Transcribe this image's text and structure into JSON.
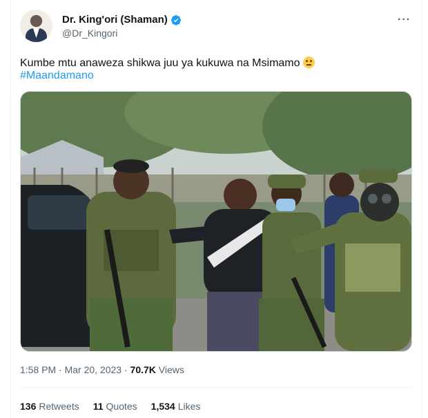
{
  "author": {
    "name": "Dr. King'ori (Shaman)",
    "handle": "@Dr_Kingori",
    "verified": true
  },
  "tweet": {
    "text": "Kumbe mtu anaweza shikwa juu ya kukuwa na Msimamo",
    "emoji": "thinking-face",
    "hashtag": "#Maandamano",
    "photo_alt": "Police officers in camouflage uniforms, one wearing a gas mask, escorting a man in a black and white sweater"
  },
  "meta": {
    "time": "1:58 PM",
    "separator": "·",
    "date": "Mar 20, 2023",
    "views_count": "70.7K",
    "views_label": "Views"
  },
  "stats": {
    "retweets_count": "136",
    "retweets_label": "Retweets",
    "quotes_count": "11",
    "quotes_label": "Quotes",
    "likes_count": "1,534",
    "likes_label": "Likes"
  },
  "colors": {
    "accent": "#1d9bf0",
    "text": "#0f1419",
    "secondary": "#536471",
    "border": "#eff3f4"
  }
}
